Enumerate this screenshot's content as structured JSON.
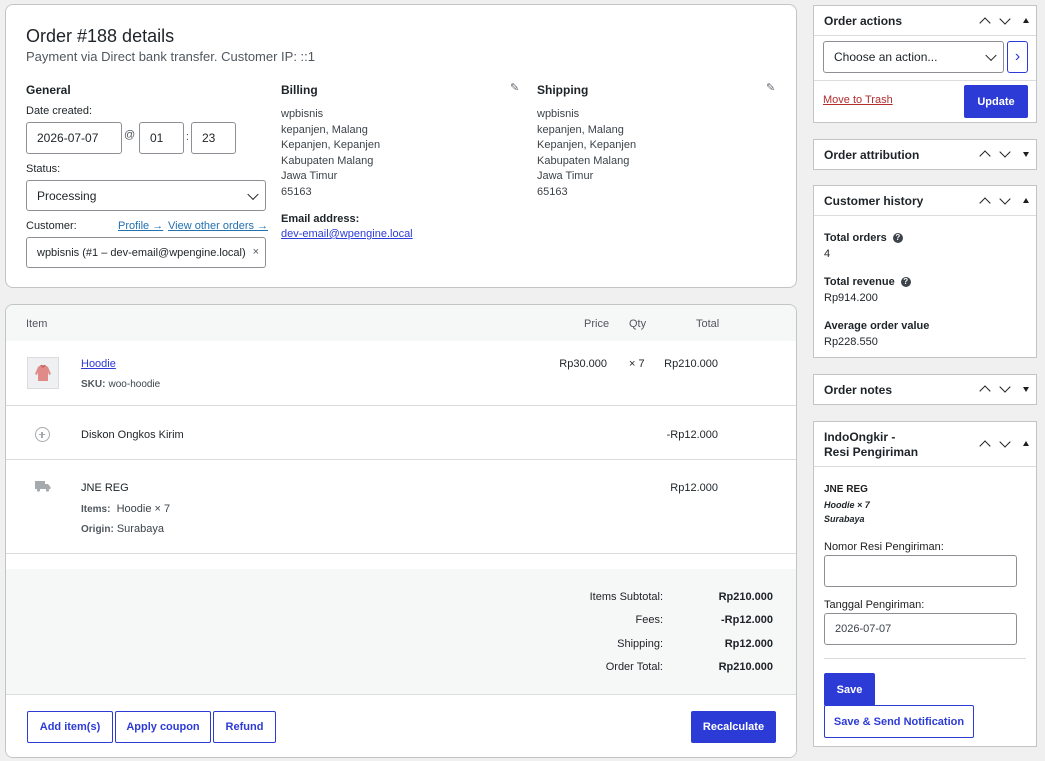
{
  "order": {
    "title": "Order #188 details",
    "subtitle": "Payment via Direct bank transfer. Customer IP: ::1"
  },
  "general": {
    "heading": "General",
    "date_label": "Date created:",
    "date_value": "2026-07-07",
    "at": "@",
    "hour": "01",
    "colon": ":",
    "minute": "23",
    "status_label": "Status:",
    "status_value": "Processing",
    "customer_label": "Customer:",
    "profile_link": "Profile →",
    "view_orders_link": "View other orders →",
    "customer_value": "wpbisnis (#1 – dev-email@wpengine.local)",
    "clear_glyph": "×"
  },
  "billing": {
    "heading": "Billing",
    "address": "wpbisnis\nkepanjen, Malang\nKepanjen, Kepanjen\nKabupaten Malang\nJawa Timur\n65163",
    "email_label": "Email address:",
    "email": "dev-email@wpengine.local"
  },
  "shipping": {
    "heading": "Shipping",
    "address": "wpbisnis\nkepanjen, Malang\nKepanjen, Kepanjen\nKabupaten Malang\nJawa Timur\n65163"
  },
  "items": {
    "headers": {
      "item": "Item",
      "price": "Price",
      "qty": "Qty",
      "total": "Total"
    },
    "line": {
      "name": "Hoodie",
      "sku_label": "SKU:",
      "sku": "woo-hoodie",
      "price": "Rp30.000",
      "qty": "× 7",
      "total": "Rp210.000"
    },
    "fee": {
      "name": "Diskon Ongkos Kirim",
      "total": "-Rp12.000"
    },
    "shipping_line": {
      "name": "JNE REG",
      "items_label": "Items:",
      "items_value": "Hoodie × 7",
      "origin_label": "Origin:",
      "origin_value": "Surabaya",
      "total": "Rp12.000"
    },
    "totals": {
      "subtotal_label": "Items Subtotal:",
      "subtotal": "Rp210.000",
      "fees_label": "Fees:",
      "fees": "-Rp12.000",
      "shipping_label": "Shipping:",
      "shipping": "Rp12.000",
      "order_total_label": "Order Total:",
      "order_total": "Rp210.000"
    },
    "buttons": {
      "add_items": "Add item(s)",
      "apply_coupon": "Apply coupon",
      "refund": "Refund",
      "recalculate": "Recalculate"
    }
  },
  "sidebar": {
    "order_actions": {
      "title": "Order actions",
      "select_value": "Choose an action...",
      "go_glyph": "›",
      "trash": "Move to Trash",
      "update": "Update"
    },
    "order_attribution": {
      "title": "Order attribution"
    },
    "customer_history": {
      "title": "Customer history",
      "total_orders_label": "Total orders",
      "total_orders": "4",
      "total_revenue_label": "Total revenue",
      "total_revenue": "Rp914.200",
      "avg_label": "Average order value",
      "avg_value": "Rp228.550",
      "help_glyph": "?"
    },
    "order_notes": {
      "title": "Order notes"
    },
    "indoongkir": {
      "title_line1": "IndoOngkir -",
      "title_line2": "Resi Pengiriman",
      "courier": "JNE REG",
      "items": "Hoodie × 7",
      "origin": "Surabaya",
      "resi_label": "Nomor Resi Pengiriman:",
      "resi_value": "",
      "date_label": "Tanggal Pengiriman:",
      "date_value": "2026-07-07",
      "save": "Save",
      "save_send": "Save & Send Notification"
    }
  },
  "colors": {
    "accent": "#2c3bd6",
    "link": "#2271b1",
    "trash": "#b32d2e",
    "bg": "#f0f0f1"
  }
}
